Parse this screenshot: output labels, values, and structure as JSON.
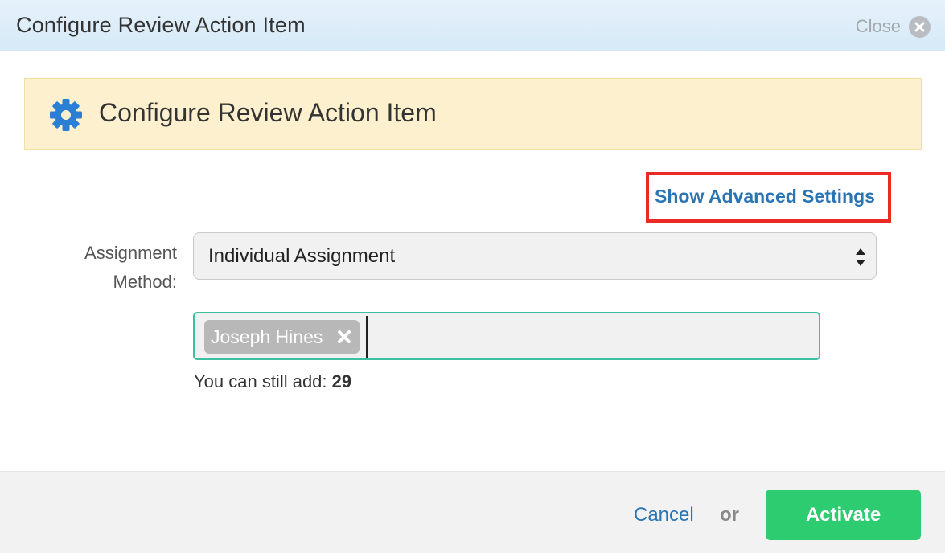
{
  "window": {
    "title": "Configure Review Action Item",
    "close_label": "Close"
  },
  "banner": {
    "icon": "gear-icon",
    "heading": "Configure Review Action Item"
  },
  "advanced_link": "Show Advanced Settings",
  "form": {
    "assignment_label": "Assignment Method:",
    "assignment_value": "Individual Assignment",
    "assignees": [
      "Joseph Hines"
    ],
    "remaining_prefix": "You can still add:",
    "remaining_count": "29"
  },
  "footer": {
    "cancel_label": "Cancel",
    "or_text": "or",
    "activate_label": "Activate"
  },
  "colors": {
    "link": "#2a74b4",
    "primary_button": "#2ecc71",
    "banner_bg": "#fcf0ce",
    "highlight_box": "#ec2a24",
    "token_field_border": "#3fbfa2"
  }
}
